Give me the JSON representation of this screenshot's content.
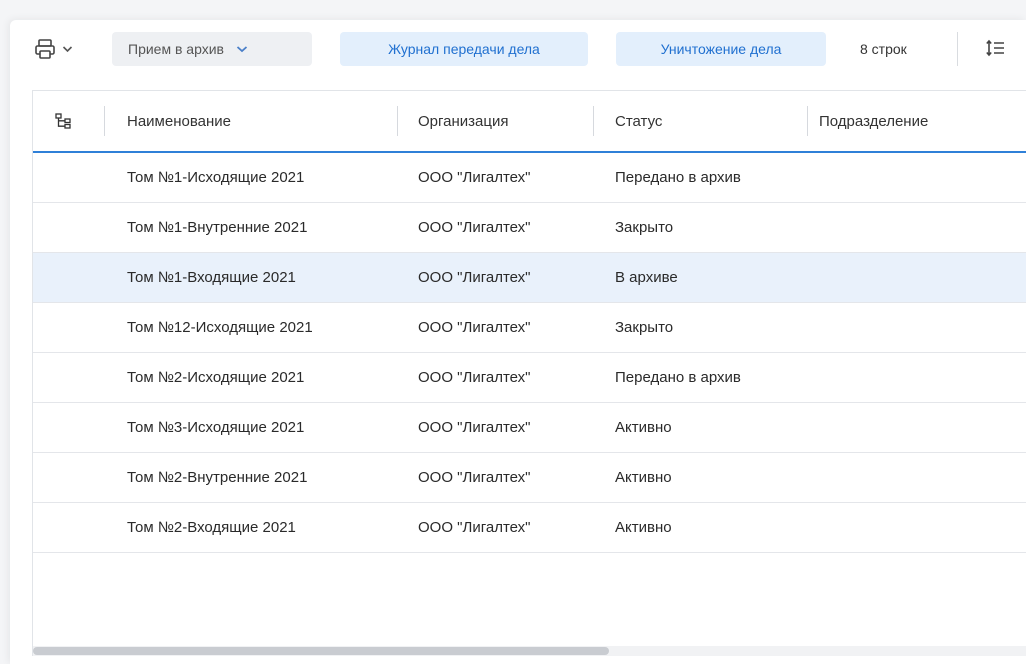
{
  "toolbar": {
    "print_icon": "printer-icon",
    "dropdown_icon": "chevron-down-icon",
    "archive_intake_label": "Прием в архив",
    "transfer_journal_label": "Журнал передачи дела",
    "destroy_case_label": "Уничтожение дела",
    "rows_count": "8 строк",
    "row_height_icon": "row-height-icon",
    "accent_color": "#2070d0"
  },
  "table": {
    "tree_icon": "hierarchy-icon",
    "columns": [
      "Наименование",
      "Организация",
      "Статус",
      "Подразделение"
    ],
    "selected_row": 2,
    "rows": [
      {
        "name": "Том №1-Исходящие 2021",
        "org": "ООО \"Лигалтех\"",
        "status": "Передано в архив",
        "dept": ""
      },
      {
        "name": "Том №1-Внутренние 2021",
        "org": "ООО \"Лигалтех\"",
        "status": "Закрыто",
        "dept": ""
      },
      {
        "name": "Том №1-Входящие 2021",
        "org": "ООО \"Лигалтех\"",
        "status": "В архиве",
        "dept": ""
      },
      {
        "name": "Том №12-Исходящие 2021",
        "org": "ООО \"Лигалтех\"",
        "status": "Закрыто",
        "dept": ""
      },
      {
        "name": "Том №2-Исходящие 2021",
        "org": "ООО \"Лигалтех\"",
        "status": "Передано в архив",
        "dept": ""
      },
      {
        "name": "Том №3-Исходящие 2021",
        "org": "ООО \"Лигалтех\"",
        "status": "Активно",
        "dept": ""
      },
      {
        "name": "Том №2-Внутренние 2021",
        "org": "ООО \"Лигалтех\"",
        "status": "Активно",
        "dept": ""
      },
      {
        "name": "Том №2-Входящие 2021",
        "org": "ООО \"Лигалтех\"",
        "status": "Активно",
        "dept": ""
      }
    ]
  }
}
